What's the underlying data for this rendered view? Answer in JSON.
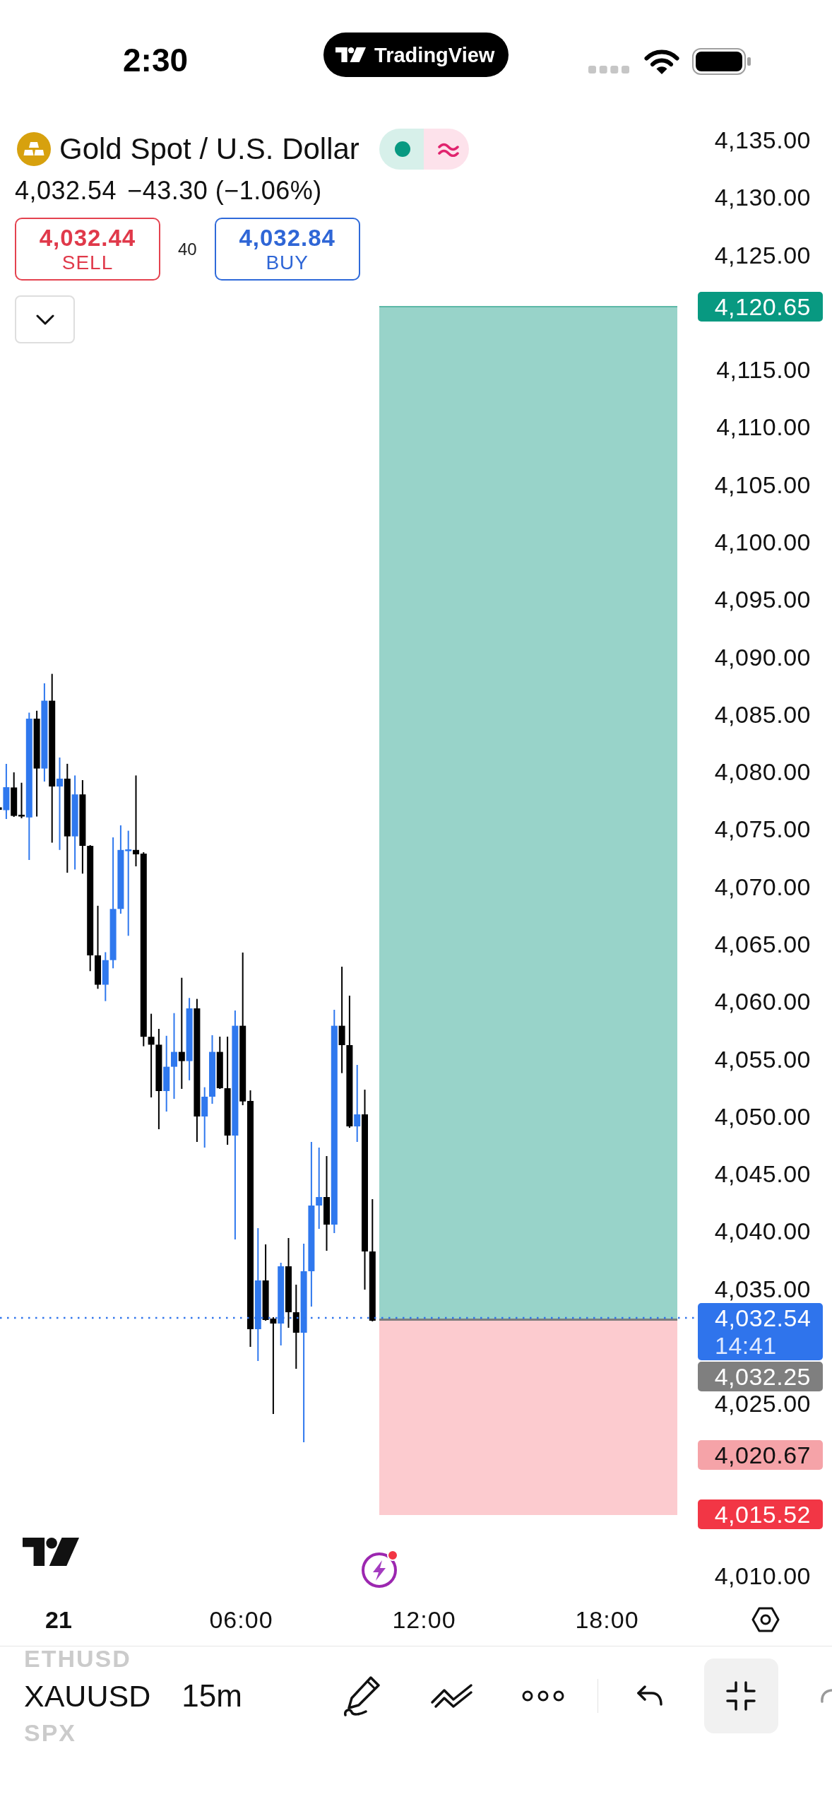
{
  "status_bar": {
    "time": "2:30",
    "live_activity": "TradingView"
  },
  "header": {
    "title": "Gold Spot / U.S. Dollar",
    "market_open": true,
    "last_price": "4,032.54",
    "change": "−43.30 (−1.06%)",
    "sell": {
      "price": "4,032.44",
      "label": "SELL"
    },
    "spread": "40",
    "buy": {
      "price": "4,032.84",
      "label": "BUY"
    }
  },
  "price_axis": [
    {
      "kind": "tick",
      "text": "4,135.00"
    },
    {
      "kind": "tick",
      "text": "4,130.00"
    },
    {
      "kind": "tick",
      "text": "4,125.00"
    },
    {
      "kind": "target",
      "text": "4,120.65",
      "color": "#089981"
    },
    {
      "kind": "tick",
      "text": "4,115.00"
    },
    {
      "kind": "tick",
      "text": "4,110.00"
    },
    {
      "kind": "tick",
      "text": "4,105.00"
    },
    {
      "kind": "tick",
      "text": "4,100.00"
    },
    {
      "kind": "tick",
      "text": "4,095.00"
    },
    {
      "kind": "tick",
      "text": "4,090.00"
    },
    {
      "kind": "tick",
      "text": "4,085.00"
    },
    {
      "kind": "tick",
      "text": "4,080.00"
    },
    {
      "kind": "tick",
      "text": "4,075.00"
    },
    {
      "kind": "tick",
      "text": "4,070.00"
    },
    {
      "kind": "tick",
      "text": "4,065.00"
    },
    {
      "kind": "tick",
      "text": "4,060.00"
    },
    {
      "kind": "tick",
      "text": "4,055.00"
    },
    {
      "kind": "tick",
      "text": "4,050.00"
    },
    {
      "kind": "tick",
      "text": "4,045.00"
    },
    {
      "kind": "tick",
      "text": "4,040.00"
    },
    {
      "kind": "tick",
      "text": "4,035.00"
    },
    {
      "kind": "last",
      "text": "4,032.54",
      "countdown": "14:41",
      "color": "#2f74ec"
    },
    {
      "kind": "entry",
      "text": "4,032.25",
      "color": "#7f7f7f"
    },
    {
      "kind": "tick",
      "text": "4,025.00"
    },
    {
      "kind": "marker",
      "text": "4,020.67",
      "color": "#f5a3a8"
    },
    {
      "kind": "stop",
      "text": "4,015.52",
      "color": "#f23645"
    },
    {
      "kind": "tick",
      "text": "4,010.00"
    }
  ],
  "time_axis": [
    {
      "kind": "day",
      "text": "21"
    },
    {
      "kind": "time",
      "text": "06:00"
    },
    {
      "kind": "time",
      "text": "12:00"
    },
    {
      "kind": "time",
      "text": "18:00"
    }
  ],
  "toolbar": {
    "symbols": [
      {
        "text": "ETHUSD",
        "selected": false
      },
      {
        "text": "XAUUSD",
        "selected": true
      },
      {
        "text": "SPX",
        "selected": false
      }
    ],
    "interval": "15m"
  }
}
